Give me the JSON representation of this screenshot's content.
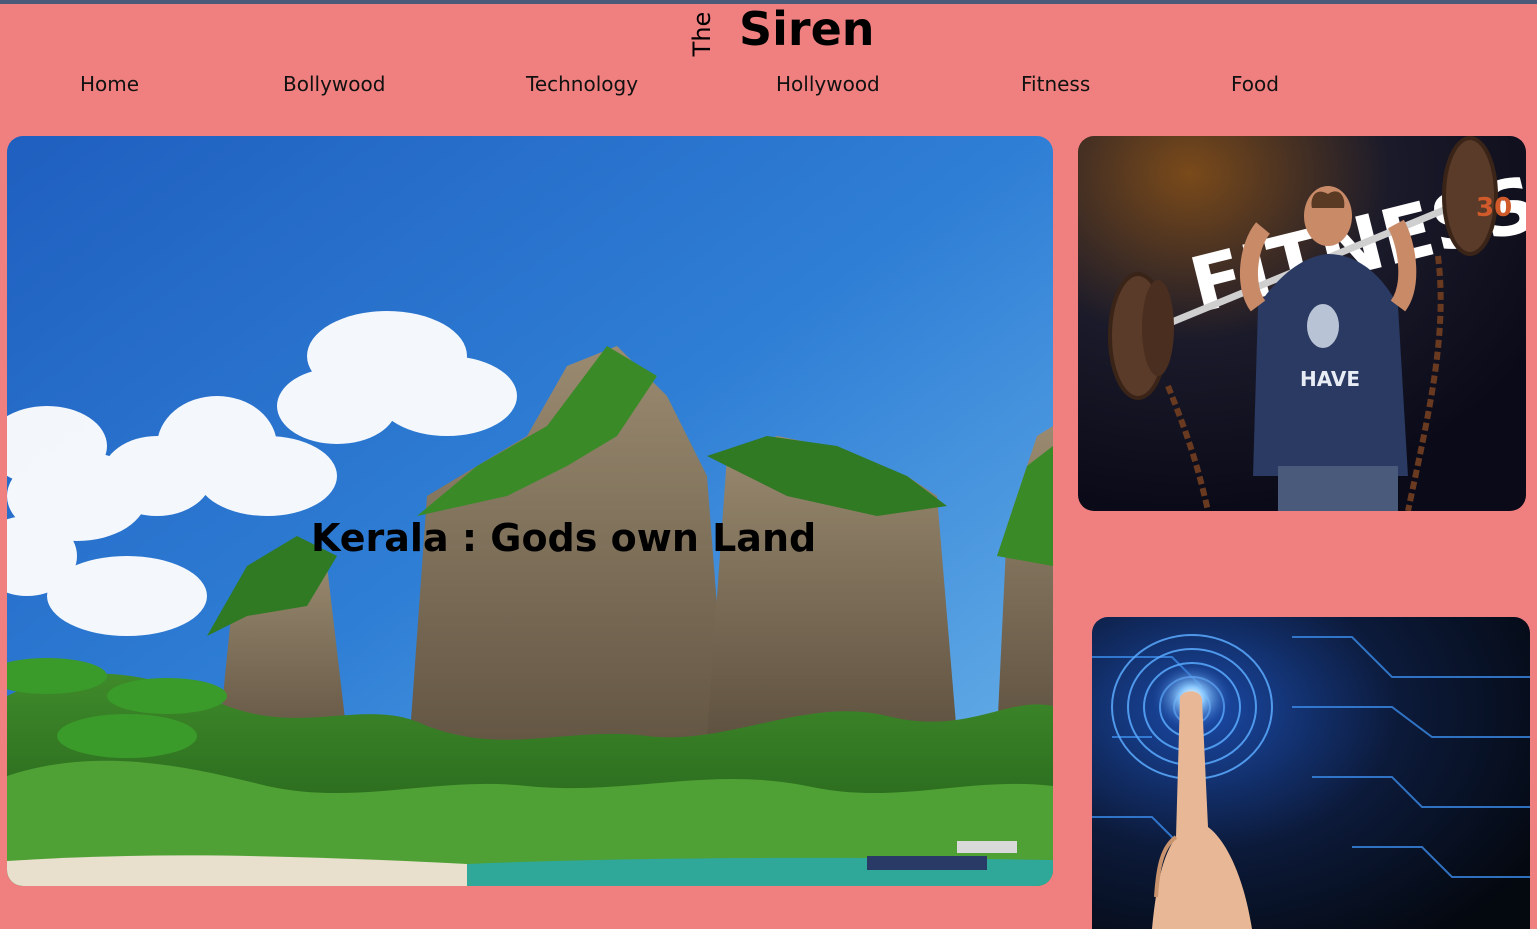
{
  "header": {
    "logo_small": "The",
    "logo_main": "Siren"
  },
  "nav": {
    "items": [
      {
        "label": "Home"
      },
      {
        "label": "Bollywood"
      },
      {
        "label": "Technology"
      },
      {
        "label": "Hollywood"
      },
      {
        "label": "Fitness"
      },
      {
        "label": "Food"
      }
    ]
  },
  "hero": {
    "caption": "Kerala : Gods own Land",
    "image": "tropical-limestone-mountain-beach-photo"
  },
  "side_cards": {
    "fitness": {
      "image": "fitness-man-barbell-photo",
      "art_text": "FITNESS",
      "plate_text": "30",
      "shirt_text": "HAVE"
    },
    "technology": {
      "image": "fingerprint-circuit-touch-photo"
    }
  },
  "colors": {
    "background": "#f08080",
    "top_strip": "#4a5a78",
    "text": "#000000"
  }
}
